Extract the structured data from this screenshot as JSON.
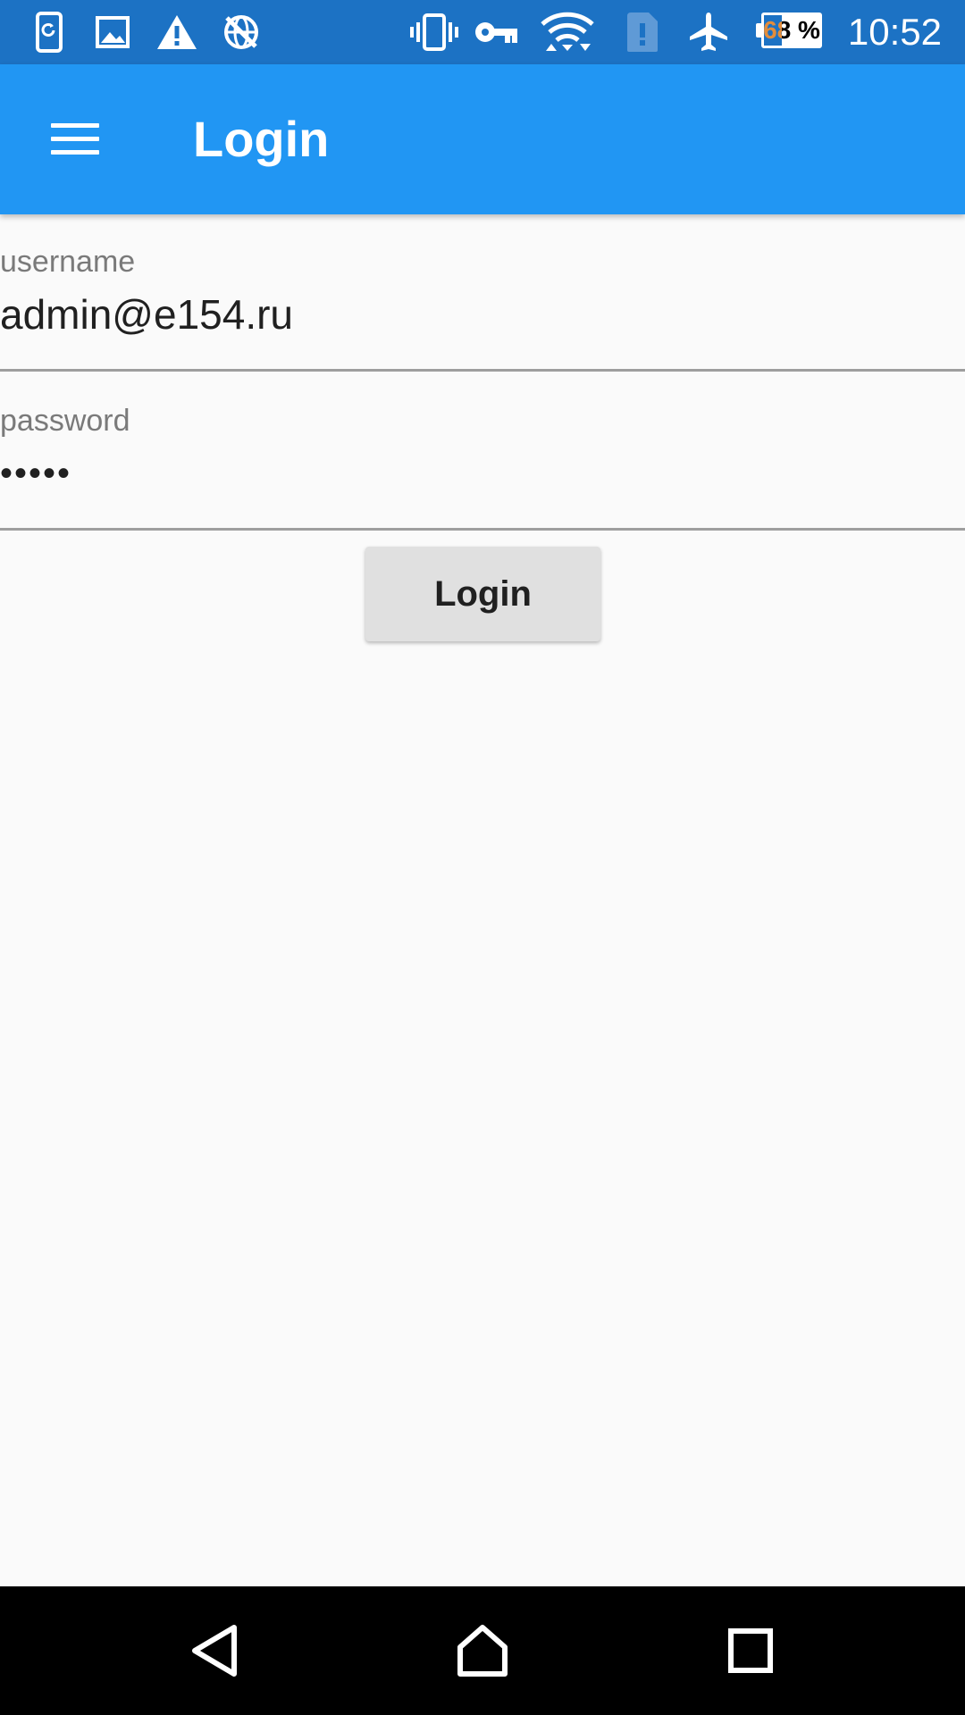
{
  "status_bar": {
    "left_icons": [
      "phone-sync-icon",
      "image-icon",
      "warning-icon",
      "globe-off-icon"
    ],
    "right_icons": [
      "vibrate-icon",
      "vpn-key-icon",
      "wifi-icon",
      "sim-alert-icon",
      "airplane-icon"
    ],
    "battery_percent": 68,
    "battery_label": "68 %",
    "time": "10:52",
    "background_color": "#1c72c4"
  },
  "app_bar": {
    "title": "Login",
    "menu_icon": "hamburger-menu-icon",
    "background_color": "#2196f3"
  },
  "form": {
    "username": {
      "label": "username",
      "value": "admin@e154.ru"
    },
    "password": {
      "label": "password",
      "value": "•••••"
    },
    "submit_label": "Login"
  },
  "nav_bar": {
    "buttons": [
      "back-icon",
      "home-icon",
      "recents-icon"
    ]
  }
}
